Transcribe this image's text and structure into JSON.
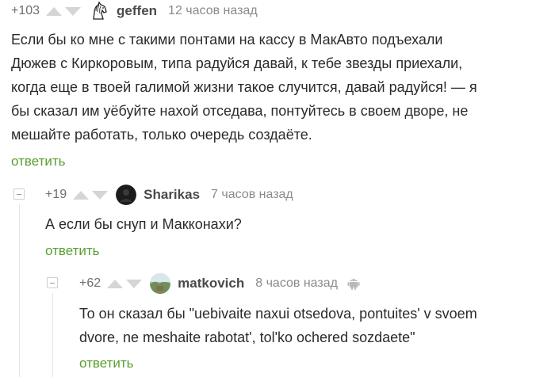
{
  "comments": [
    {
      "rating": "+103",
      "author": "geffen",
      "time": "12 часов назад",
      "text_lines": [
        "Если бы ко мне с такими понтами на кассу в МакАвто подъехали",
        "Дюжев с Киркоровым, типа радуйся давай, к тебе звезды приехали,",
        "когда еще в твоей галимой жизни такое случится, давай радуйся! — я",
        "бы сказал им уёбуйте нахой отседава, понтуйтесь в своем дворе, не",
        "мешайте работать, только очередь создаёте."
      ],
      "reply_label": "ответить",
      "avatar_icon": "horse-avatar-icon"
    },
    {
      "rating": "+19",
      "author": "Sharikas",
      "time": "7 часов назад",
      "text_lines": [
        "А если бы снуп и Макконахи?"
      ],
      "reply_label": "ответить",
      "avatar_icon": "dark-avatar-icon"
    },
    {
      "rating": "+62",
      "author": "matkovich",
      "time": "8 часов назад",
      "text_lines": [
        "То он сказал бы \"uebivaite naxui otsedova, pontuites' v svoem",
        "dvore, ne meshaite rabotat', tol'ko ochered sozdaete\""
      ],
      "reply_label": "ответить",
      "avatar_icon": "landscape-avatar-icon",
      "platform_icon": "android-icon"
    }
  ],
  "colors": {
    "link_green": "#5a9e2f",
    "vote_gray": "#d5d5d5",
    "text": "#2b2b2b",
    "muted": "#8b8b8b"
  }
}
